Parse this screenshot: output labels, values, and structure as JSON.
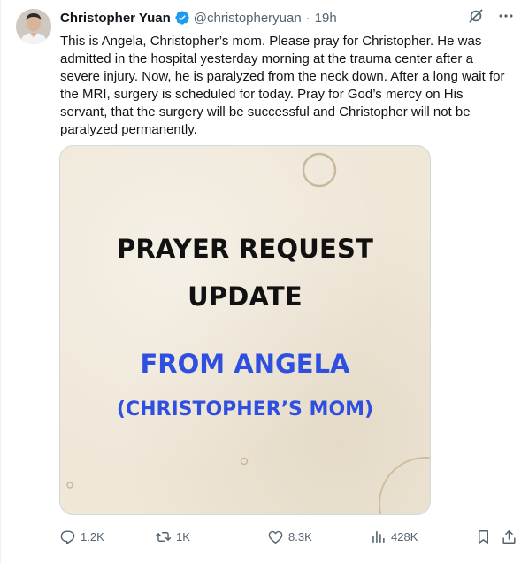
{
  "tweet": {
    "display_name": "Christopher Yuan",
    "handle": "@christopheryuan",
    "separator": "·",
    "time": "19h",
    "text": "This is Angela, Christopher’s mom. Please pray for Christopher. He was admitted in the hospital yesterday morning at the trauma center after a severe injury. Now, he is paralyzed from the neck down. After a long wait for the MRI, surgery is scheduled for today. Pray for God’s mercy on His servant, that the surgery will be successful and Christopher will not be paralyzed permanently."
  },
  "image": {
    "line1": "PRAYER REQUEST",
    "line2": "UPDATE",
    "line3": "FROM ANGELA",
    "line4": "(CHRISTOPHER’S MOM)"
  },
  "actions": {
    "replies": "1.2K",
    "reposts": "1K",
    "likes": "8.3K",
    "views": "428K"
  },
  "icons": {
    "verified": "verified-badge-icon",
    "grok": "grok-icon",
    "more": "more-icon",
    "reply": "reply-icon",
    "repost": "repost-icon",
    "like": "like-icon",
    "views": "views-icon",
    "bookmark": "bookmark-icon",
    "share": "share-icon"
  },
  "colors": {
    "verified": "#1d9bf0",
    "secondary_text": "#536471",
    "image_title": "#111111",
    "image_accent": "#2f4fe0",
    "image_background": "#efe7d8"
  }
}
